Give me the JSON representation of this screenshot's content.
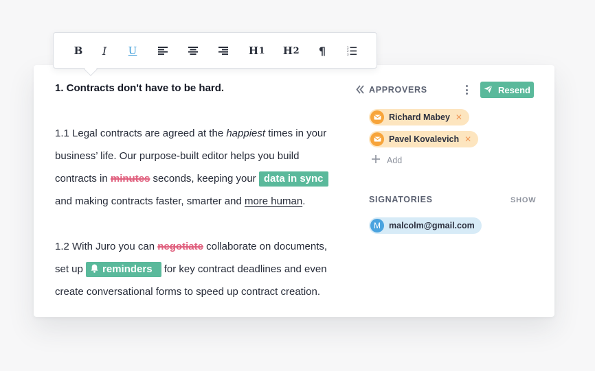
{
  "toolbar": {
    "bold_label": "B",
    "italic_label": "I",
    "underline_label": "U",
    "h1_label": "H",
    "h1_sup": "1",
    "h2_label": "H",
    "h2_sup": "2",
    "paragraph_label": "¶",
    "icons": [
      "align-left-icon",
      "align-center-icon",
      "align-right-icon",
      "numbered-list-icon"
    ],
    "accent_color": "#3a9bd8"
  },
  "document": {
    "heading": "1. Contracts don't have to be hard.",
    "p1": {
      "line1_a": "1.1 Legal contracts are agreed at the ",
      "line1_em": "happiest",
      "line1_b": " times in your",
      "line2": "business’ life. Our purpose-built editor helps you build",
      "line3_a": "contracts in ",
      "line3_strike": "minutes",
      "line3_b": " seconds, keeping your ",
      "line3_tag": "data in sync",
      "line4_a": "and making contracts faster, smarter and ",
      "line4_link": "more human",
      "line4_b": "."
    },
    "p2": {
      "line1_a": "1.2 With Juro you can ",
      "line1_strike": "negotiate",
      "line1_b": " collaborate on documents,",
      "line2_a": "set up ",
      "line2_tag": "reminders",
      "line2_b": " for key contract deadlines and even",
      "line3": "create conversational forms to speed up contract creation."
    },
    "colors": {
      "strike": "#e0607e",
      "tag": "#5ab99b"
    }
  },
  "panel": {
    "approvers_title": "APPROVERS",
    "resend_label": "Resend",
    "approvers": [
      {
        "name": "Richard Mabey"
      },
      {
        "name": "Pavel Kovalevich"
      }
    ],
    "add_label": "Add",
    "signatories_title": "SIGNATORIES",
    "show_label": "SHOW",
    "signatories": [
      {
        "initial": "M",
        "email": "malcolm@gmail.com"
      }
    ]
  }
}
